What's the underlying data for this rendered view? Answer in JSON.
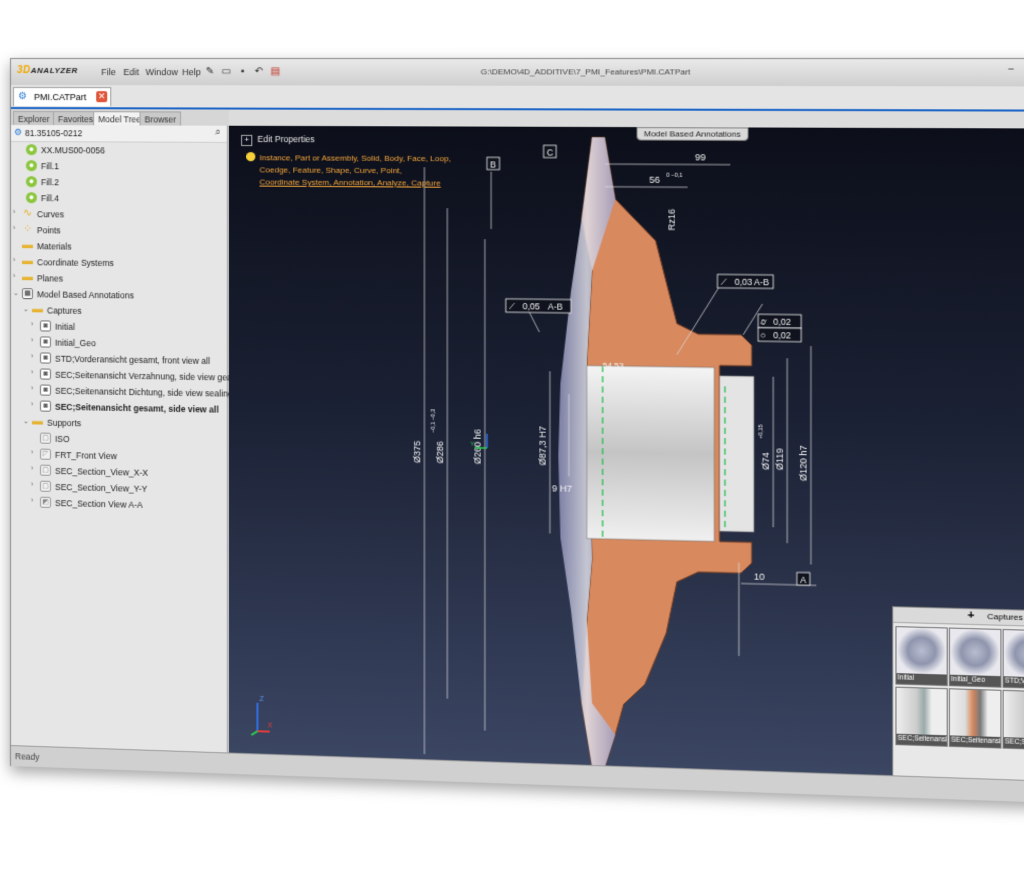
{
  "app": {
    "logo_main": "3D",
    "logo_sub": "ANALYZER",
    "menu": [
      "File",
      "Edit",
      "Window",
      "Help"
    ],
    "path": "G:\\DEMO\\4D_ADDITIVE\\7_PMI_Features\\PMI.CATPart",
    "window_controls": [
      "−",
      "□",
      "✕"
    ]
  },
  "doc_tab": {
    "label": "PMI.CATPart",
    "close": "✕"
  },
  "side_tabs": [
    "Explorer",
    "Favorites",
    "Model Tree",
    "Browser"
  ],
  "tree": {
    "root": "81.35105-0212",
    "items": [
      {
        "label": "XX.MUS00-0056",
        "icon": "solid-icon"
      },
      {
        "label": "Fill.1",
        "icon": "solid-icon"
      },
      {
        "label": "Fill.2",
        "icon": "solid-icon"
      },
      {
        "label": "Fill.4",
        "icon": "solid-icon"
      },
      {
        "label": "Curves",
        "icon": "curves-icon"
      },
      {
        "label": "Points",
        "icon": "points-icon"
      },
      {
        "label": "Materials",
        "icon": "folder-icon"
      },
      {
        "label": "Coordinate Systems",
        "icon": "folder-icon"
      },
      {
        "label": "Planes",
        "icon": "folder-icon"
      },
      {
        "label": "Model Based Annotations",
        "icon": "annotations-icon"
      },
      {
        "label": "Captures",
        "icon": "folder-icon"
      },
      {
        "label": "Initial",
        "icon": "capture-icon"
      },
      {
        "label": "Initial_Geo",
        "icon": "capture-icon"
      },
      {
        "label": "STD;Vorderansicht gesamt, front view all",
        "icon": "capture-icon"
      },
      {
        "label": "SEC;Seitenansicht Verzahnung, side view gearing",
        "icon": "capture-icon"
      },
      {
        "label": "SEC;Seitenansicht Dichtung, side view sealing",
        "icon": "capture-icon"
      },
      {
        "label": "SEC;Seitenansicht gesamt, side view all",
        "icon": "capture-icon"
      },
      {
        "label": "Supports",
        "icon": "folder-icon"
      },
      {
        "label": "ISO",
        "icon": "support-icon"
      },
      {
        "label": "FRT_Front View",
        "icon": "support-icon"
      },
      {
        "label": "SEC_Section_View_X-X",
        "icon": "support-icon"
      },
      {
        "label": "SEC_Section_View_Y-Y",
        "icon": "support-icon"
      },
      {
        "label": "SEC_Section View A-A",
        "icon": "support-icon"
      }
    ]
  },
  "viewport": {
    "edit_properties": "Edit Properties",
    "hint_lines": [
      "Instance, Part or Assembly, Solid, Body, Face, Loop,",
      "Coedge, Feature, Shape, Curve, Point,",
      "Coordinate System, Annotation, Analyze, Capture"
    ],
    "mba_tab": "Model Based Annotations",
    "dims": {
      "d99": "99",
      "d56": "56",
      "d56_tol": "0 −0,1",
      "rz": "Rz16",
      "flat1": "0,03",
      "flat1_ref": "A-B",
      "perp": "0,05",
      "perp_ref": "A-B",
      "pos1": "0,02",
      "pos2": "0,02",
      "d375": "Ø375",
      "d286": "Ø286",
      "d286_tol": "−0,1 −0,3",
      "d260": "Ø260 h6",
      "d87": "Ø87,3 H7",
      "h9": "9 H7",
      "d74": "Ø74",
      "d74_tol": "+0,15",
      "d119": "Ø119",
      "d120": "Ø120 h7",
      "d10": "10",
      "d54": "54,53",
      "datB": "B",
      "datC": "C",
      "datA": "A"
    }
  },
  "captures": {
    "title": "Captures",
    "add": "+",
    "thumbs": [
      "Initial",
      "Initial_Geo",
      "STD;Vorderansic...",
      "SEC;Seitenansic...",
      "SEC;Seitenansic...",
      "SEC;Seitenansic..."
    ]
  },
  "status": "Ready"
}
